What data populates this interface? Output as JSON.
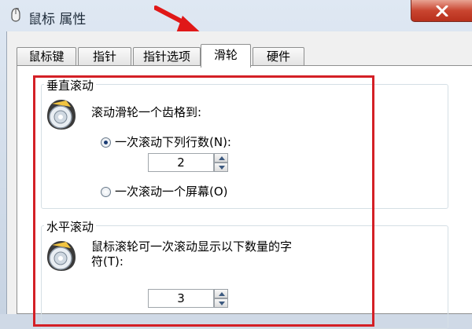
{
  "window": {
    "title": "鼠标 属性"
  },
  "tabs": [
    {
      "label": "鼠标键",
      "active": false
    },
    {
      "label": "指针",
      "active": false
    },
    {
      "label": "指针选项",
      "active": false
    },
    {
      "label": "滑轮",
      "active": true
    },
    {
      "label": "硬件",
      "active": false
    }
  ],
  "vertical": {
    "title": "垂直滚动",
    "prompt": "滚动滑轮一个齿格到:",
    "option_lines": "一次滚动下列行数(N):",
    "lines_value": "2",
    "option_screen": "一次滚动一个屏幕(O)"
  },
  "horizontal": {
    "title": "水平滚动",
    "prompt_line1": "鼠标滚轮可一次滚动显示以下数量的字",
    "prompt_line2": "符(T):",
    "chars_value": "3"
  },
  "colors": {
    "annotation_red": "#d42026",
    "close_button": "#c94530"
  }
}
